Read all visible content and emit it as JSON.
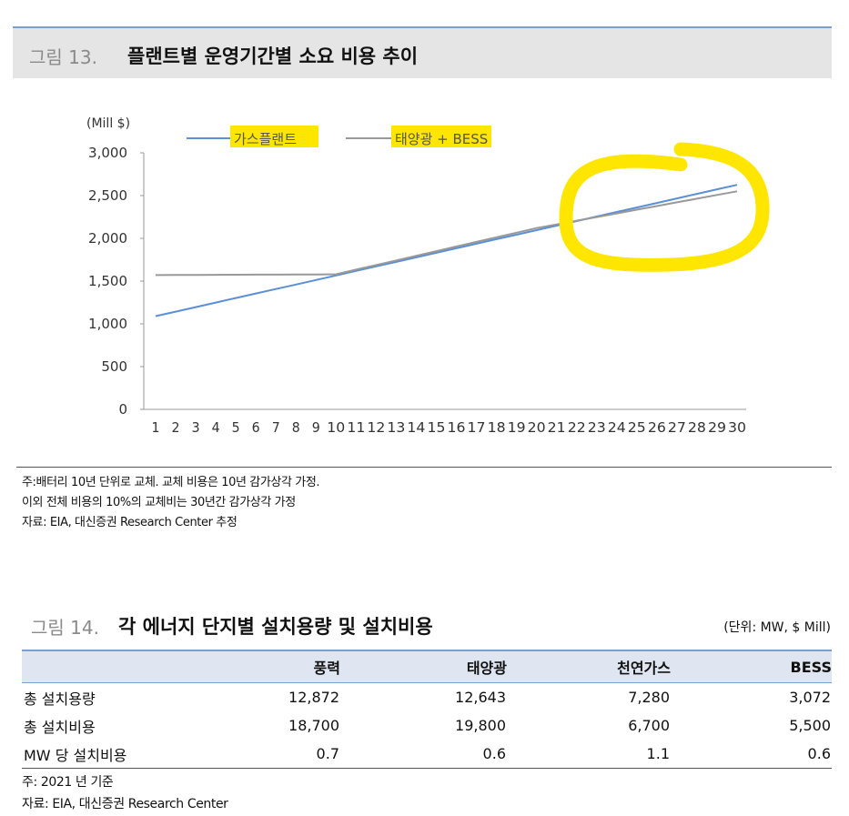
{
  "fig13": {
    "number": "그림 13.",
    "title": "플랜트별 운영기간별 소요 비용 추이"
  },
  "chart_data": {
    "type": "line",
    "unit": "(Mill $)",
    "x": [
      1,
      2,
      3,
      4,
      5,
      6,
      7,
      8,
      9,
      10,
      11,
      12,
      13,
      14,
      15,
      16,
      17,
      18,
      19,
      20,
      21,
      22,
      23,
      24,
      25,
      26,
      27,
      28,
      29,
      30
    ],
    "xticks": [
      "1",
      "2",
      "3",
      "4",
      "5",
      "6",
      "7",
      "8",
      "9",
      "10",
      "11",
      "12",
      "13",
      "14",
      "15",
      "16",
      "17",
      "18",
      "19",
      "20",
      "21",
      "22",
      "23",
      "24",
      "25",
      "26",
      "27",
      "28",
      "29",
      "30"
    ],
    "ylim": [
      0,
      3000
    ],
    "yticks": [
      "0",
      "500",
      "1,000",
      "1,500",
      "2,000",
      "2,500",
      "3,000"
    ],
    "ytick_values": [
      0,
      500,
      1000,
      1500,
      2000,
      2500,
      3000
    ],
    "grid": false,
    "legend_position": "top",
    "series": [
      {
        "name": "가스플랜트",
        "color": "#5b8fd6",
        "values": [
          1090,
          1143,
          1196,
          1249,
          1302,
          1355,
          1407,
          1460,
          1513,
          1566,
          1619,
          1672,
          1725,
          1778,
          1831,
          1884,
          1937,
          1990,
          2043,
          2096,
          2149,
          2202,
          2255,
          2308,
          2361,
          2414,
          2467,
          2520,
          2573,
          2626
        ]
      },
      {
        "name": "태양광 + BESS",
        "color": "#999999",
        "values": [
          1570,
          1571,
          1572,
          1573,
          1574,
          1575,
          1576,
          1577,
          1578,
          1580,
          1634,
          1688,
          1742,
          1796,
          1850,
          1904,
          1958,
          2012,
          2066,
          2120,
          2163,
          2206,
          2249,
          2292,
          2335,
          2378,
          2421,
          2464,
          2507,
          2550
        ]
      }
    ],
    "highlight_color": "#ffe600"
  },
  "notes13": [
    "주:배터리 10년 단위로 교체. 교체 비용은 10년 감가상각 가정.",
    "이외 전체 비용의 10%의 교체비는 30년간 감가상각 가정",
    "자료: EIA, 대신증권 Research Center 추정"
  ],
  "fig14": {
    "number": "그림 14.",
    "title": "각 에너지 단지별 설치용량 및 설치비용",
    "unit": "(단위: MW, $ Mill)",
    "columns": [
      "",
      "풍력",
      "태양광",
      "천연가스",
      "BESS"
    ],
    "rows": [
      [
        "총 설치용량",
        "12,872",
        "12,643",
        "7,280",
        "3,072"
      ],
      [
        "총 설치비용",
        "18,700",
        "19,800",
        "6,700",
        "5,500"
      ],
      [
        "MW 당 설치비용",
        "0.7",
        "0.6",
        "1.1",
        "0.6"
      ]
    ],
    "notes": [
      "주: 2021 년 기준",
      "자료: EIA, 대신증권 Research Center"
    ]
  }
}
